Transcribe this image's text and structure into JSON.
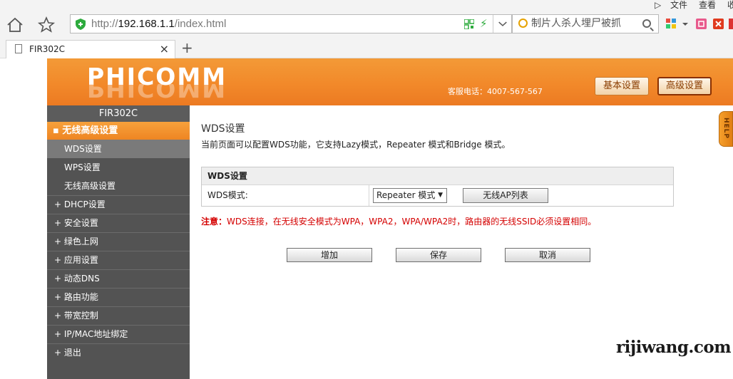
{
  "browser": {
    "menu": [
      "文件",
      "查看",
      "收"
    ],
    "url_prefix": "http://",
    "url_host": "192.168.1.1",
    "url_path": "/index.html",
    "search_text": "制片人杀人埋尸被抓",
    "tab_title": "FIR302C",
    "tab_close": "×",
    "new_tab": "+"
  },
  "header": {
    "logo": "PHICOMM",
    "phone": "客服电话：4007-567-567",
    "basic_btn": "基本设置",
    "advanced_btn": "高级设置"
  },
  "sidebar": {
    "title": "FIR302C",
    "group": "无线高级设置",
    "subs": [
      "WDS设置",
      "WPS设置",
      "无线高级设置"
    ],
    "items": [
      "DHCP设置",
      "安全设置",
      "绿色上网",
      "应用设置",
      "动态DNS",
      "路由功能",
      "带宽控制",
      "IP/MAC地址绑定",
      "退出"
    ]
  },
  "help": "HELP",
  "content": {
    "title": "WDS设置",
    "desc": "当前页面可以配置WDS功能，它支持Lazy模式，Repeater 模式和Bridge 模式。",
    "table_header": "WDS设置",
    "mode_label": "WDS模式:",
    "mode_value": "Repeater 模式",
    "ap_list_btn": "无线AP列表",
    "note_label": "注意：",
    "note_text": "WDS连接，在无线安全模式为WPA，WPA2，WPA/WPA2时，路由器的无线SSID必须设置相同。",
    "add_btn": "增加",
    "save_btn": "保存",
    "cancel_btn": "取消"
  },
  "watermark": "rijiwang.com",
  "colors": {
    "header": "#f2892a",
    "sidebar": "#535353",
    "note": "#d40000"
  }
}
